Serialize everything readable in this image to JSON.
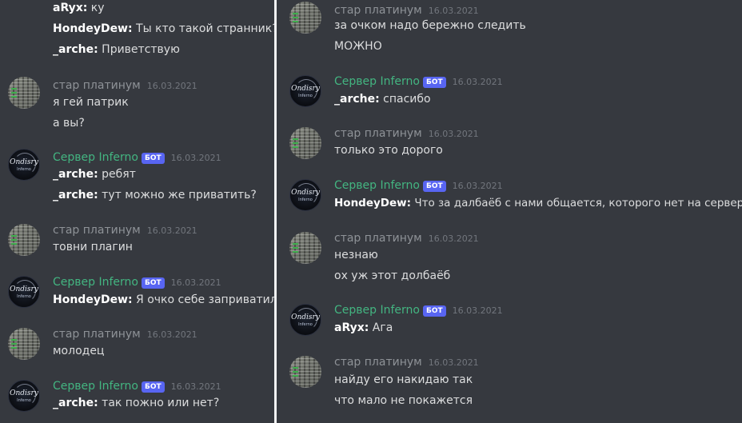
{
  "common": {
    "bot_tag": "БОТ",
    "date": "16.03.2021"
  },
  "users": {
    "star": "стар платинум",
    "bot": "Сервер Inferno"
  },
  "bot_avatar": {
    "logo_text": "Ondisry",
    "logo_sub": "Inferno"
  },
  "left": {
    "top": [
      {
        "author": "aRyx:",
        "text": " ку"
      },
      {
        "author": "HondeyDew:",
        "text": " Ты кто такой странник?"
      },
      {
        "author": "_arche:",
        "text": " Приветствую"
      }
    ],
    "m1": {
      "lines": [
        "я гей патрик",
        "а вы?"
      ]
    },
    "m2": {
      "lines": [
        {
          "author": "_arche:",
          "text": " ребят"
        },
        {
          "author": "_arche:",
          "text": " тут можно же приватить?"
        }
      ]
    },
    "m3": {
      "lines": [
        "товни плагин"
      ]
    },
    "m4": {
      "lines": [
        {
          "author": "HondeyDew:",
          "text": " Я очко себе заприватил"
        }
      ]
    },
    "m5": {
      "lines": [
        "молодец"
      ]
    },
    "m6": {
      "lines": [
        {
          "author": "_arche:",
          "text": " так пожно или нет?"
        }
      ]
    }
  },
  "right": {
    "r1": {
      "lines": [
        "за очком надо бережно следить",
        "МОЖНО"
      ]
    },
    "r2": {
      "lines": [
        {
          "author": "_arche:",
          "text": " спасибо"
        }
      ]
    },
    "r3": {
      "lines": [
        "только это дорого"
      ]
    },
    "r4": {
      "lines": [
        {
          "author": "HondeyDew:",
          "text": " Что за далбаёб с нами общается, которого нет на сервере?"
        }
      ]
    },
    "r5": {
      "lines": [
        "незнаю",
        "ох уж этот долбаёб"
      ]
    },
    "r6": {
      "lines": [
        {
          "author": "aRyx:",
          "text": " Ага"
        }
      ]
    },
    "r7": {
      "lines": [
        "найду его накидаю так",
        "что мало не покажется"
      ]
    }
  }
}
